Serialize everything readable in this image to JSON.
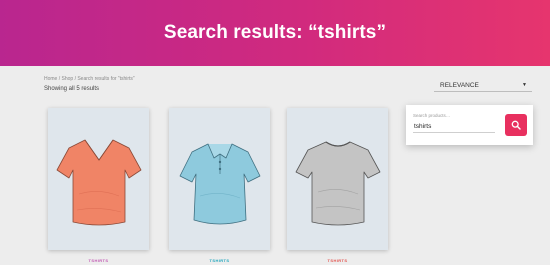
{
  "hero": {
    "title": "Search results: “tshirts”"
  },
  "breadcrumb": "Home / Shop / Search results for “tshirts”",
  "result_count": "Showing all 5 results",
  "sort": {
    "selected": "RELEVANCE"
  },
  "search": {
    "placeholder": "Search products…",
    "value": "tshirts"
  },
  "products": [
    {
      "title": "TSHIRTS",
      "color": "#f08466",
      "title_color": "#c35ab4"
    },
    {
      "title": "TSHIRTS",
      "color": "#8ecadd",
      "title_color": "#1fa6bd"
    },
    {
      "title": "TSHIRTS",
      "color": "#c4c4c4",
      "title_color": "#e3544f"
    }
  ],
  "colors": {
    "accent": "#e8305f",
    "hero_start": "#b9268f",
    "hero_end": "#e6356e"
  }
}
